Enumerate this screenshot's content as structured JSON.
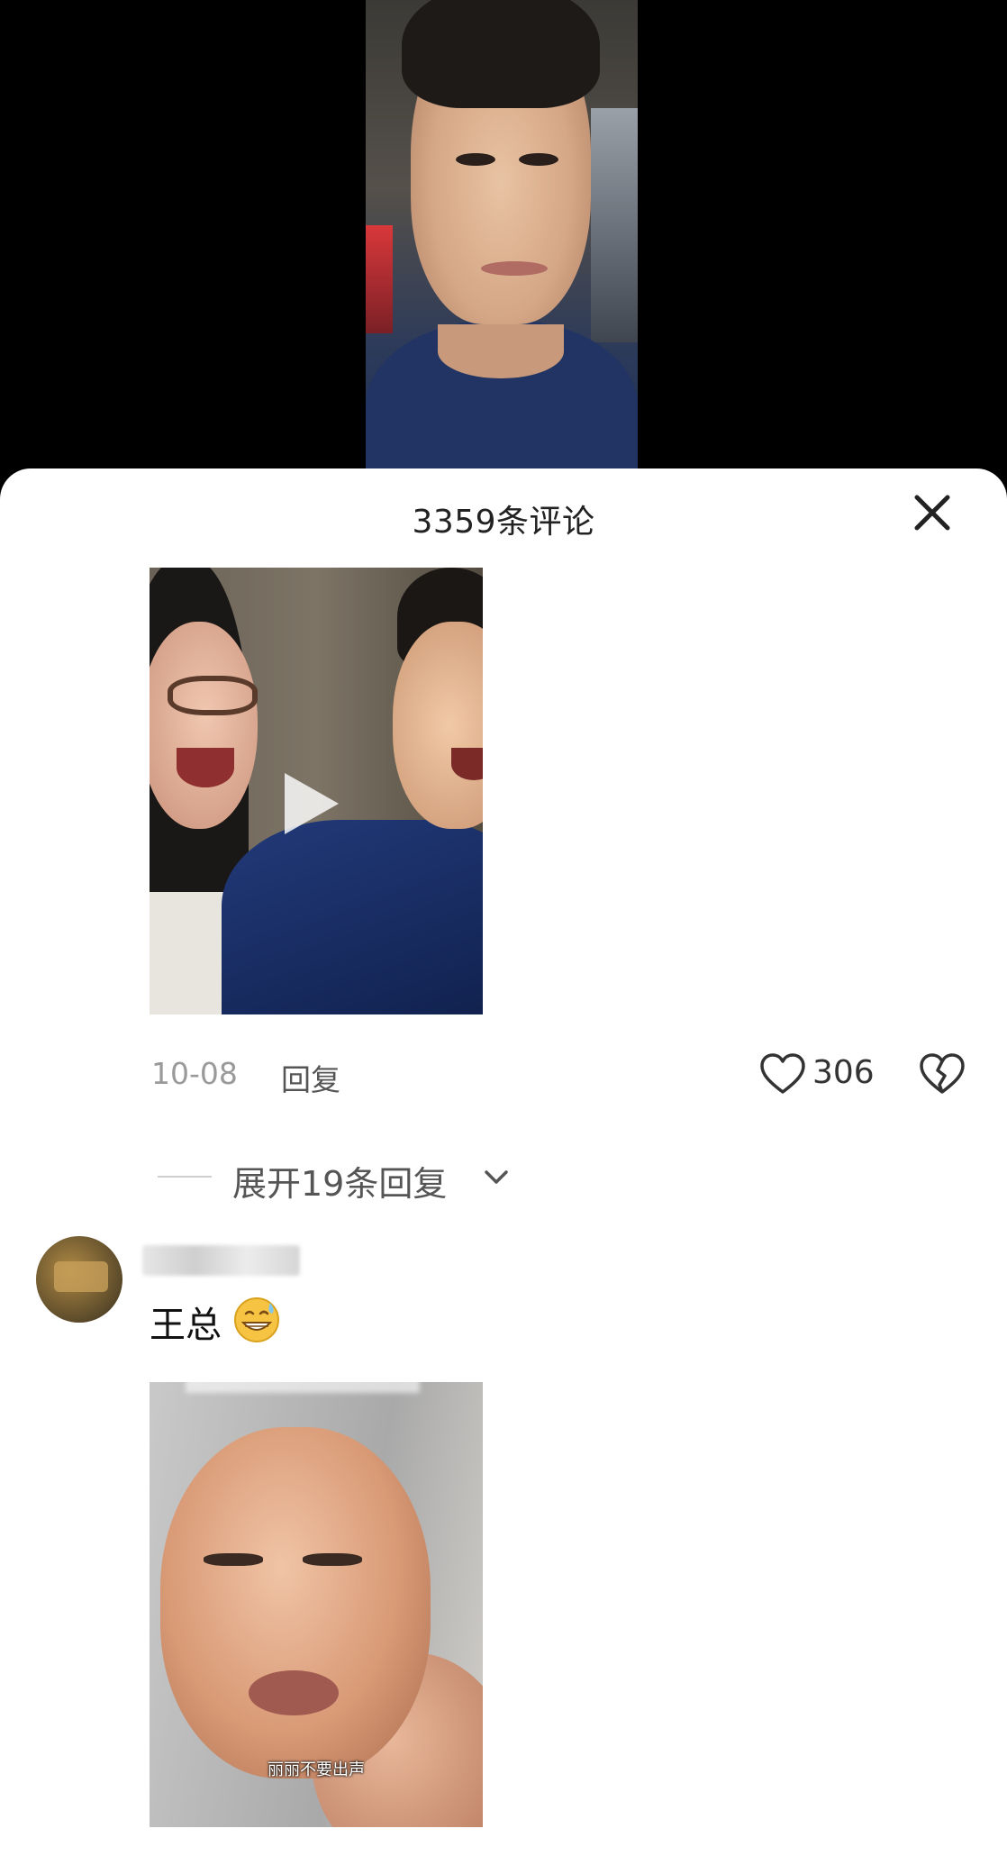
{
  "header": {
    "comment_count_title": "3359条评论"
  },
  "comments": [
    {
      "media": {
        "type": "video",
        "play_icon": "play-icon"
      },
      "date": "10-08",
      "reply_label": "回复",
      "likes": "306",
      "expand_replies_label": "展开19条回复"
    },
    {
      "text": "王总",
      "emoji": "grinning-sweat-emoji",
      "media": {
        "type": "image",
        "caption": "丽丽不要出声"
      }
    }
  ],
  "colors": {
    "sheet_bg": "#ffffff",
    "backdrop": "#000000",
    "muted_text": "#9a9a9a"
  },
  "icons": [
    "close-icon",
    "heart-icon",
    "broken-heart-icon",
    "chevron-down-icon",
    "play-icon"
  ]
}
